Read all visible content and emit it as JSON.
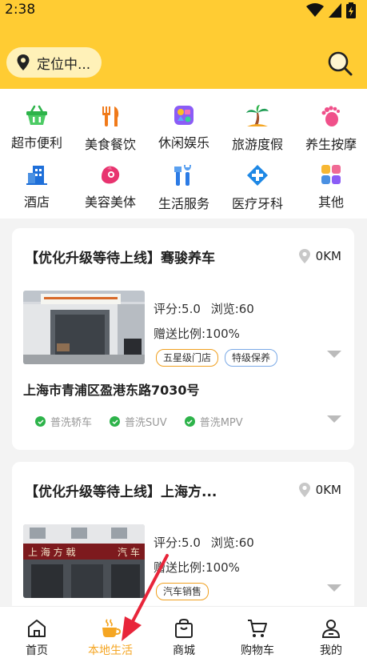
{
  "status": {
    "time": "2:38"
  },
  "header": {
    "location_label": "定位中..."
  },
  "categories": [
    {
      "label": "超市便利",
      "icon": "basket-icon"
    },
    {
      "label": "美食餐饮",
      "icon": "fork-knife-icon"
    },
    {
      "label": "休闲娱乐",
      "icon": "game-icon"
    },
    {
      "label": "旅游度假",
      "icon": "palm-tree-icon"
    },
    {
      "label": "养生按摩",
      "icon": "foot-icon"
    },
    {
      "label": "酒店",
      "icon": "hotel-icon"
    },
    {
      "label": "美容美体",
      "icon": "beauty-icon"
    },
    {
      "label": "生活服务",
      "icon": "tools-icon"
    },
    {
      "label": "医疗牙科",
      "icon": "medical-cross-icon"
    },
    {
      "label": "其他",
      "icon": "grid-icon"
    }
  ],
  "shops": [
    {
      "title": "【优化升级等待上线】骞骏养车",
      "distance": "0KM",
      "rating": "评分:5.0",
      "views": "浏览:60",
      "gift_ratio": "赠送比例:100%",
      "tags": [
        "五星级门店",
        "特级保养"
      ],
      "address": "上海市青浦区盈港东路7030号",
      "services": [
        "普洗轿车",
        "普洗SUV",
        "普洗MPV"
      ]
    },
    {
      "title": "【优化升级等待上线】上海方...",
      "distance": "0KM",
      "rating": "评分:5.0",
      "views": "浏览:60",
      "gift_ratio": "赠送比例:100%",
      "tags": [
        "汽车销售"
      ]
    }
  ],
  "tabbar": {
    "items": [
      {
        "label": "首页",
        "icon": "home-icon"
      },
      {
        "label": "本地生活",
        "icon": "coffee-cup-icon"
      },
      {
        "label": "商城",
        "icon": "shopping-bag-icon"
      },
      {
        "label": "购物车",
        "icon": "cart-icon"
      },
      {
        "label": "我的",
        "icon": "user-icon"
      }
    ],
    "active_index": 1
  },
  "colors": {
    "header": "#FFCC33",
    "accent": "#F5A623",
    "annotation_arrow": "#E8253A"
  }
}
